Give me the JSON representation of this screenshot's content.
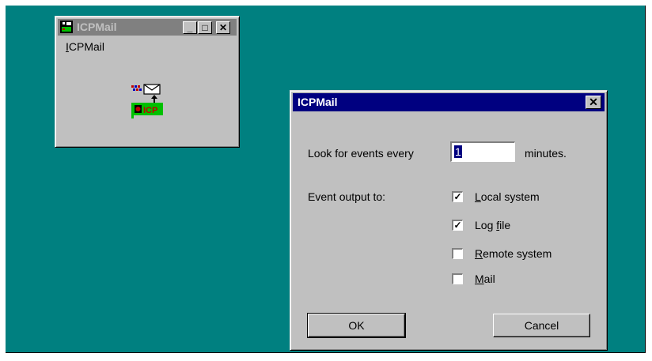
{
  "app_window": {
    "title": "ICPMail",
    "menu_label": "ICPMail",
    "menu_accel": "I",
    "menu_rest": "CPMail",
    "min_glyph": "_",
    "max_glyph": "□",
    "close_glyph": "✕",
    "icon_text": "ICP"
  },
  "dialog": {
    "title": "ICPMail",
    "close_glyph": "✕",
    "interval_prefix": "Look for events every",
    "interval_value": "1",
    "interval_suffix": "minutes.",
    "output_label": "Event output to:",
    "options": [
      {
        "accel": "L",
        "rest": "ocal system",
        "checked": true
      },
      {
        "pre": "Log ",
        "accel": "f",
        "rest": "ile",
        "checked": true
      },
      {
        "accel": "R",
        "rest": "emote system",
        "checked": false
      },
      {
        "accel": "M",
        "rest": "ail",
        "checked": false
      }
    ],
    "ok_label": "OK",
    "cancel_label": "Cancel"
  },
  "colors": {
    "desktop": "#008080",
    "active_title": "#000080",
    "inactive_title": "#808080",
    "face": "#c0c0c0"
  }
}
